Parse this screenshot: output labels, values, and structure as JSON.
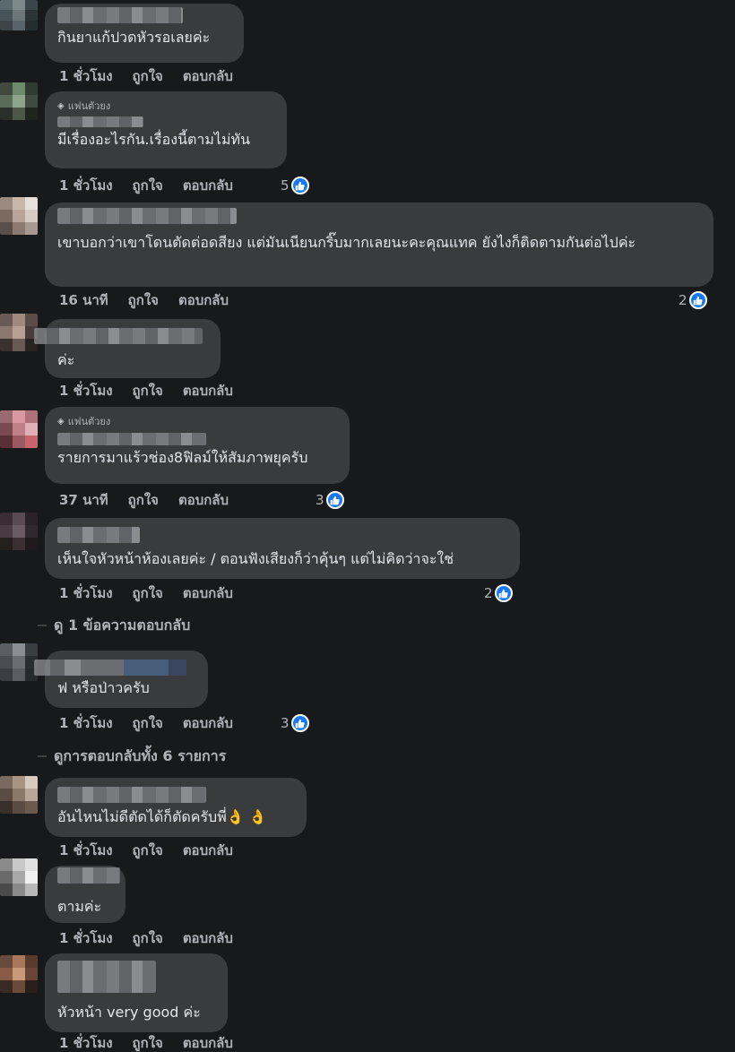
{
  "actions": {
    "like": "ถูกใจ",
    "reply": "ตอบกลับ"
  },
  "fan_badge": "แฟนตัวยง",
  "comments": [
    {
      "text": "กินยาแก้ปวดหัวรอเลยค่ะ",
      "time": "1 ชั่วโมง"
    },
    {
      "text": "มีเรื่องอะไรกัน.เรื่องนี้ตามไม่ทัน",
      "time": "1 ชั่วโมง",
      "reactions": "5"
    },
    {
      "text": "เขาบอกว่าเขาโดนตัดต่อดสียง แต่มันเนียนกริ๊บมากเลยนะคะคุณแทค ยังไงก็ติดตามกันต่อไปค่ะ",
      "time": "16 นาที",
      "reactions": "2"
    },
    {
      "text": "ค่ะ",
      "time": "1 ชั่วโมง"
    },
    {
      "text": "รายการมาแร้วช่อง8ฟิลม์ให้สัมภาพยุครับ",
      "time": "37 นาที",
      "reactions": "3"
    },
    {
      "text": "เห็นใจหัวหน้าห้องเลยค่ะ / ตอนฟังเสียงก็ว่าคุ้นๆ แต่ไม่คิดว่าจะใช่",
      "time": "1 ชั่วโมง",
      "reactions": "2"
    },
    {
      "text": "ฟ หรือป่าวครับ",
      "time": "1 ชั่วโมง",
      "reactions": "3"
    },
    {
      "text": "อันไหนไม่ดีตัดได้ก็ตัดครับพี่",
      "emoji": "👌 👌",
      "time": "1 ชั่วโมง"
    },
    {
      "text": "ตามค่ะ",
      "time": "1 ชั่วโมง"
    },
    {
      "text": "หัวหน้า very good ค่ะ",
      "time": "1 ชั่วโมง"
    }
  ],
  "view_replies": [
    {
      "label": "ดู 1 ข้อความตอบกลับ"
    },
    {
      "label": "ดูการตอบกลับทั้ง 6 รายการ"
    }
  ],
  "colors": {
    "background": "#18191a",
    "bubble": "#3a3b3c",
    "like_blue": "#1877f2",
    "meta": "#b0b3b8"
  }
}
